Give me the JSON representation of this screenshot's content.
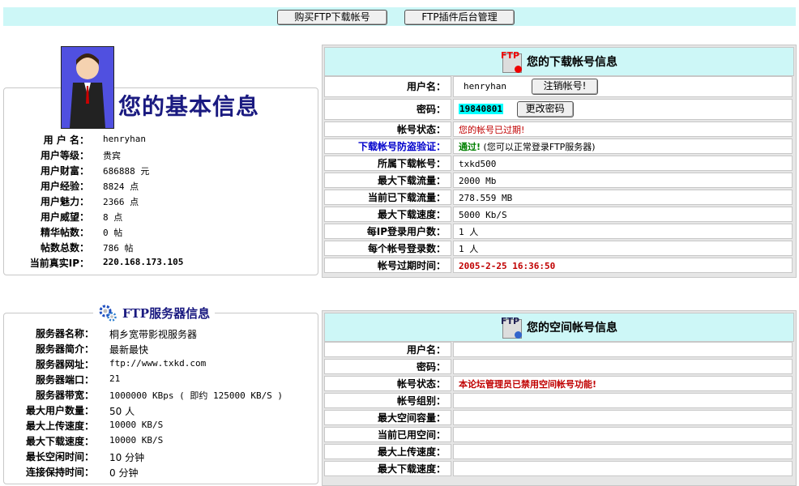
{
  "toolbar": {
    "buy_button": "购买FTP下载帐号",
    "admin_button": "FTP插件后台管理"
  },
  "basic_info": {
    "title": "您的基本信息",
    "rows": [
      {
        "label": "用 户 名：",
        "value": "henryhan"
      },
      {
        "label": "用户等级：",
        "value": "贵宾"
      },
      {
        "label": "用户财富：",
        "value": "686888 元"
      },
      {
        "label": "用户经验：",
        "value": "8824 点"
      },
      {
        "label": "用户魅力：",
        "value": "2366 点"
      },
      {
        "label": "用户威望：",
        "value": "8 点"
      },
      {
        "label": "精华帖数：",
        "value": "0 帖"
      },
      {
        "label": "帖数总数：",
        "value": "786 帖"
      },
      {
        "label": "当前真实IP：",
        "value": "220.168.173.105"
      }
    ]
  },
  "download_account": {
    "icon_text": "FTP",
    "title": "您的下载帐号信息",
    "username_label": "用户名：",
    "username_value": "henryhan",
    "logout_button": "注销帐号!",
    "password_label": "密码：",
    "password_value": "19840801",
    "change_password_button": "更改密码",
    "status_label": "帐号状态：",
    "status_value": "您的帐号已过期!",
    "antileech_label": "下载帐号防盗验证：",
    "antileech_pass": "通过!",
    "antileech_note": "(您可以正常登录FTP服务器)",
    "rows": [
      {
        "label": "所属下载帐号：",
        "value": "txkd500"
      },
      {
        "label": "最大下载流量：",
        "value": "2000 Mb"
      },
      {
        "label": "当前已下载流量：",
        "value": "278.559 MB"
      },
      {
        "label": "最大下载速度：",
        "value": "5000 Kb/S"
      },
      {
        "label": "每IP登录用户数：",
        "value": "1 人"
      },
      {
        "label": "每个帐号登录数：",
        "value": "1 人"
      }
    ],
    "expire_label": "帐号过期时间：",
    "expire_value": "2005-2-25 16:36:50"
  },
  "ftp_server": {
    "title": "FTP服务器信息",
    "rows": [
      {
        "label": "服务器名称：",
        "value": "桐乡宽带影视服务器"
      },
      {
        "label": "服务器简介：",
        "value": "最新最快"
      },
      {
        "label": "服务器网址：",
        "value": "ftp://www.txkd.com"
      },
      {
        "label": "服务器端口：",
        "value": "21"
      },
      {
        "label": "服务器带宽：",
        "value": "1000000 KBps ( 即约 125000 KB/S )"
      },
      {
        "label": "最大用户数量：",
        "value": "50 人"
      },
      {
        "label": "最大上传速度：",
        "value": "10000 KB/S"
      },
      {
        "label": "最大下载速度：",
        "value": "10000 KB/S"
      },
      {
        "label": "最长空闲时间：",
        "value": "10 分钟"
      },
      {
        "label": "连接保持时间：",
        "value": "0 分钟"
      }
    ]
  },
  "space_account": {
    "icon_text": "FTP",
    "title": "您的空间帐号信息",
    "rows": [
      {
        "label": "用户名：",
        "value": ""
      },
      {
        "label": "密码：",
        "value": ""
      },
      {
        "label": "帐号状态：",
        "value": "本论坛管理员已禁用空间帐号功能!"
      },
      {
        "label": "帐号组别：",
        "value": ""
      },
      {
        "label": "最大空间容量：",
        "value": ""
      },
      {
        "label": "当前已用空间：",
        "value": ""
      },
      {
        "label": "最大上传速度：",
        "value": ""
      },
      {
        "label": "最大下载速度：",
        "value": ""
      }
    ]
  },
  "colors": {
    "header_bg": "#cdf7f7",
    "alert_red": "#c00000",
    "pass_green": "#008000",
    "title_navy": "#1a1a80",
    "highlight": "#00ffff"
  }
}
